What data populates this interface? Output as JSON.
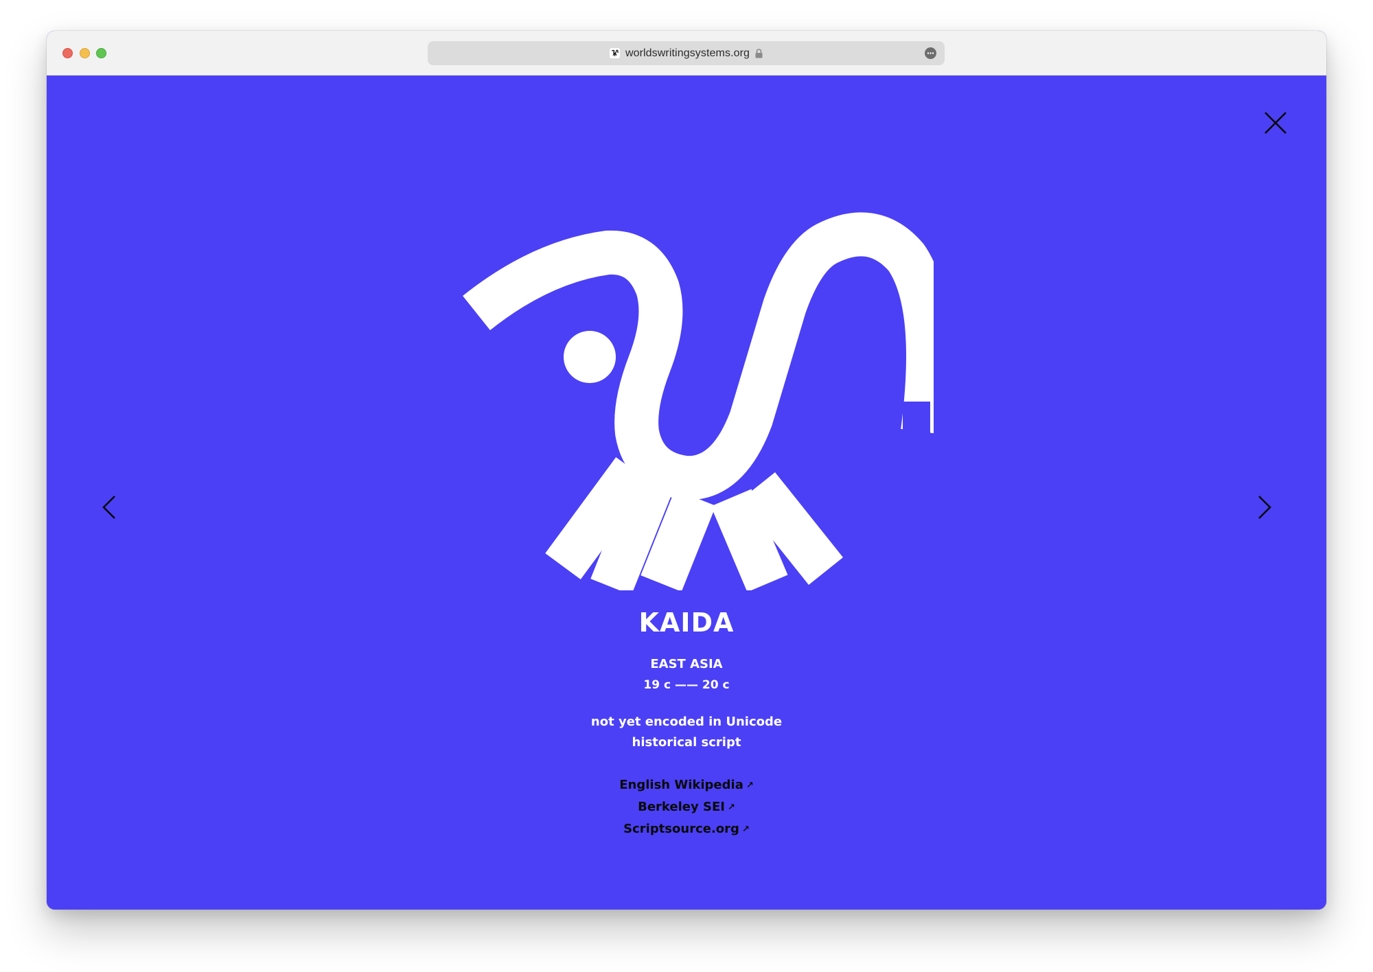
{
  "browser": {
    "url": "worldswritingsystems.org",
    "favicon": "wws-glyph-icon",
    "secure": "lock-icon",
    "menu": "ellipsis-icon"
  },
  "theme": {
    "background": "#4b40f5",
    "foreground": "#ffffff",
    "link_color": "#0a0a0a"
  },
  "script": {
    "name": "KAIDA",
    "region": "EAST ASIA",
    "period": "19 c —— 20 c",
    "unicode_status": "not yet encoded in Unicode",
    "type": "historical script",
    "glyph_icon": "kaida-glyph"
  },
  "links": [
    {
      "label": "English Wikipedia",
      "arrow": "↗"
    },
    {
      "label": "Berkeley SEI",
      "arrow": "↗"
    },
    {
      "label": "Scriptsource.org",
      "arrow": "↗"
    }
  ],
  "controls": {
    "close": "close-icon",
    "previous": "chevron-left-icon",
    "next": "chevron-right-icon"
  }
}
